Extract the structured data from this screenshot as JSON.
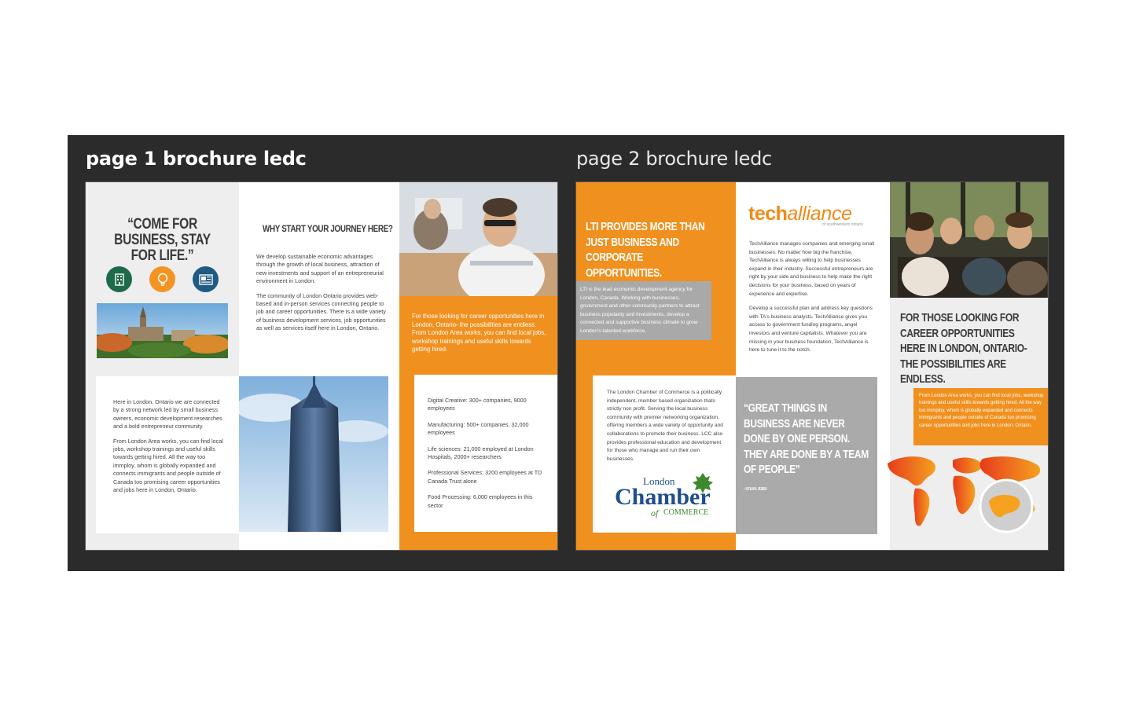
{
  "labels": {
    "page1": "page 1 brochure ledc",
    "page2": "page 2 brochure ledc"
  },
  "colors": {
    "canvas": "#2b2b2b",
    "orange": "#f0901e",
    "grey": "#aaaaaa",
    "icon_green": "#1d6b48",
    "icon_orange": "#f29424",
    "icon_blue": "#1f5a82"
  },
  "page1": {
    "quote": "“COME FOR BUSINESS, STAY FOR LIFE.”",
    "icons": [
      "building-icon",
      "lightbulb-icon",
      "newspaper-icon"
    ],
    "col1_text": [
      "Here in London, Ontario we are connected by a strong network led by small business owners, economic development researches and a bold entrepreneur community.",
      "From London Area works, you can find local jobs, workshop trainings and useful skills towards getting hired. All the way too immploy, whom is globally expanded and connects immigrants and people outside of Canada too promising career opportunities and jobs here in London, Ontario."
    ],
    "why_heading": "WHY START YOUR JOURNEY HERE?",
    "col2_text": [
      "We develop sustainable economic advantages through the growth of local business, attraction of new investments and support of an entrepreneurial environment in London.",
      "The community of London Ontario provides web-based and in-person services connecting people to job and career opportunities. There is a wide variety of business development services, job opportunities as well as services itself here in London, Ontario."
    ],
    "orange_text": "For those looking for career opportunities here in London, Ontario- the possibilities are endless. From London Area works, you can find local jobs, workshop trainings and useful skills towards getting hired.",
    "stats": [
      "Digital Creative: 300+ companies, 9000 employees",
      "Manufacturing: 500+ companies, 32,000 employees",
      "Life sciences: 21,000 employed at London Hospitals, 2000+ researchers",
      "Professional Services: 3200 employees at TD Canada Trust alone",
      "Food Processing: 6,000 employees in this sector"
    ]
  },
  "page2": {
    "heading": "LTI PROVIDES MORE THAN JUST BUSINESS AND CORPORATE OPPORTUNITIES.",
    "grey_text": "LTI is the lead economic development agency for London, Canada. Working with businesses, government and other community partners to attract business popularity and investments, develop a connected and supportive business climate to grow London's talented workforce.",
    "chamber_text": "The London Chamber of Commerce is a politically independent, member based organization thats strictly non profit. Serving the local business community with premier networking organization, offering members a wide variety of opportunity and collaborations to promote their business. LCC also provides professional education and development for those who manage and run their own businesses.",
    "chamber_logo": {
      "london": "London",
      "chamber": "Chamber",
      "of": "of",
      "commerce": "COMMERCE"
    },
    "ta_logo": {
      "tech": "tech",
      "alliance": "alliance",
      "sub": "of southwestern ontario"
    },
    "ta_text": [
      "TechAlliance manages companies and emerging small businesses. No matter how big the franchise, TechAlliance is always willing to help businesses expand in their industry. Successful entrepreneurs are right by your side and business to help make the right decisions for your business, based on years of experience and expertise.",
      "Develop a successful plan and address key questions with TA's business analysts. TechAlliance gives you access to government funding programs, angel investors and venture capitalists. Whatever you are missing in your business foundation, TechAlliance is here to tune it to the notch."
    ],
    "quote": "“GREAT THINGS IN BUSINESS ARE NEVER DONE BY ONE PERSON. THEY ARE DONE BY A TEAM OF PEOPLE”",
    "quote_author": "- STEVE JOBS",
    "col3_heading": "FOR THOSE LOOKING FOR CAREER OPPORTUNITIES HERE IN LONDON, ONTARIO- THE POSSIBILITIES ARE ENDLESS.",
    "orange_text": "From London Area works, you can find local jobs, workshop trainings and useful skills towards getting hired. All the way too immploy, whom is globally expanded and connects immigrants and people outside of Canada too promising career opportunities and jobs here in London, Ontario."
  }
}
